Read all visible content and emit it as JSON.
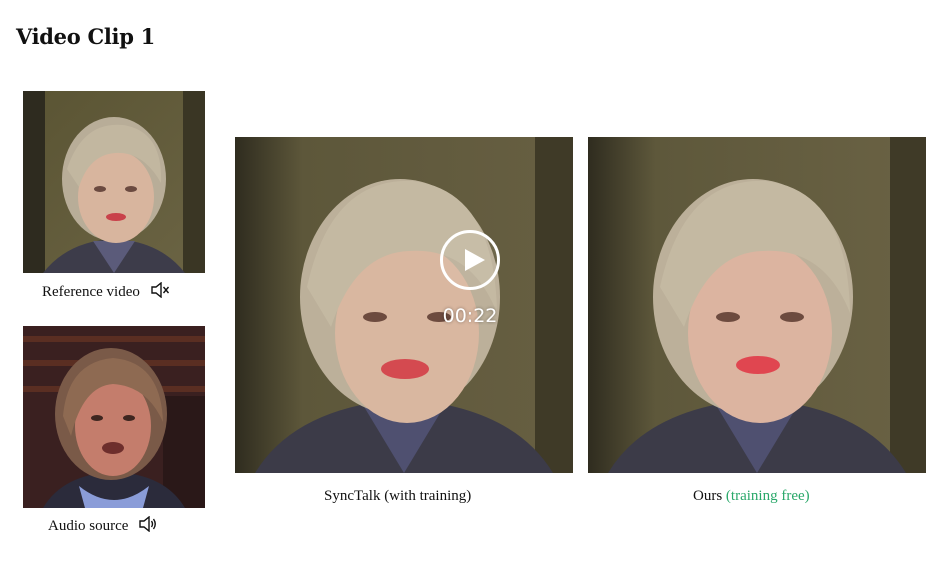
{
  "page": {
    "title": "Video Clip 1"
  },
  "panels": {
    "reference": {
      "label": "Reference video",
      "icon": "speaker-muted-icon"
    },
    "audio": {
      "label": "Audio source",
      "icon": "speaker-on-icon"
    },
    "synctalk": {
      "label": "SyncTalk (with training)"
    },
    "ours": {
      "label": "Ours",
      "label_highlight": "(training free)",
      "highlight_color": "#2aa86a"
    }
  },
  "player": {
    "time": "00:22",
    "play_icon": "play-icon"
  }
}
